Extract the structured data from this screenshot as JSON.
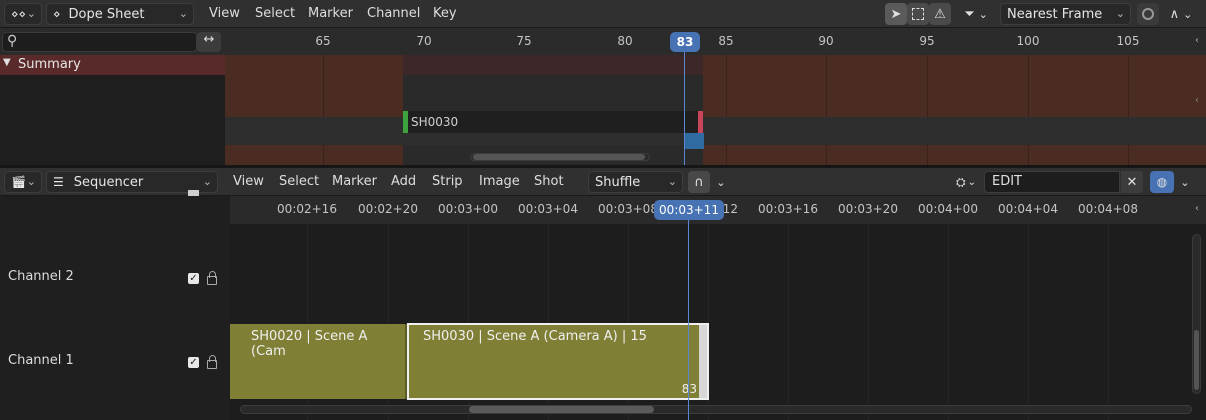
{
  "dopesheet": {
    "editor_type_icon": "dopesheet-icon",
    "mode_label": "Dope Sheet",
    "menus": [
      "View",
      "Select",
      "Marker",
      "Channel",
      "Key"
    ],
    "snapping_label": "Nearest Frame",
    "search_placeholder": "",
    "frame_ticks": [
      "65",
      "70",
      "75",
      "80",
      "85",
      "90",
      "95",
      "100",
      "105"
    ],
    "current_frame": "83",
    "summary_label": "Summary",
    "shot_label": "SH0030"
  },
  "sequencer": {
    "editor_type_icon": "clapperboard-icon",
    "mode_label": "Sequencer",
    "menus": [
      "View",
      "Select",
      "Marker",
      "Add",
      "Strip",
      "Image",
      "Shot"
    ],
    "overlap_mode": "Shuffle",
    "scene_name": "EDIT",
    "time_ticks": [
      "00:02+16",
      "00:02+20",
      "00:03+00",
      "00:03+04",
      "00:03+08",
      "00:03+12",
      "00:03+16",
      "00:03+20",
      "00:04+00",
      "00:04+04",
      "00:04+08"
    ],
    "current_time": "00:03+11",
    "channels": [
      {
        "label": "Channel 2"
      },
      {
        "label": "Channel 1"
      }
    ],
    "strips": [
      {
        "label": "SH0020 | Scene A (Cam"
      },
      {
        "label": "SH0030 | Scene A (Camera A) | 15",
        "end_frame": "83"
      }
    ]
  },
  "colors": {
    "accent": "#4772b3",
    "summary_bg": "#5a2a2b",
    "strip_scene": "#7f7f35",
    "keyframe_band": "#5a2f20"
  }
}
